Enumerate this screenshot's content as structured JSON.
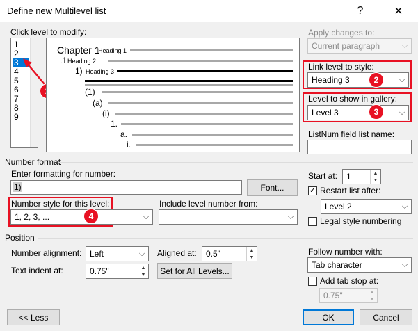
{
  "window": {
    "title": "Define new Multilevel list",
    "help_glyph": "?",
    "close_glyph": "✕"
  },
  "levels": {
    "label": "Click level to modify:",
    "items": [
      "1",
      "2",
      "3",
      "4",
      "5",
      "6",
      "7",
      "8",
      "9"
    ],
    "selected": "3"
  },
  "preview": {
    "chapter_text": "Chapter 1",
    "h1_label": "Heading 1",
    "lvl2_number": ".1",
    "h2_label": "Heading 2",
    "lvl3_number": "1)",
    "h3_label": "Heading 3",
    "lvl5_number": "(1)",
    "lvl6_number": "(a)",
    "lvl7_number": "(i)",
    "lvl8_number": "1.",
    "lvl9_a": "a.",
    "lvl9_i": "i."
  },
  "apply": {
    "label": "Apply changes to:",
    "value": "Current paragraph"
  },
  "link": {
    "label": "Link level to style:",
    "value": "Heading 3"
  },
  "gallery": {
    "label": "Level to show in gallery:",
    "value": "Level 3"
  },
  "listnum": {
    "label": "ListNum field list name:",
    "value": ""
  },
  "number_format": {
    "group_label": "Number format",
    "enter_label": "Enter formatting for number:",
    "enter_value": "1)",
    "font_button": "Font...",
    "style_label": "Number style for this level:",
    "style_value": "1, 2, 3, ...",
    "include_label": "Include level number from:",
    "include_value": "",
    "start_label": "Start at:",
    "start_value": "1",
    "restart_label": "Restart list after:",
    "restart_checked": true,
    "restart_value": "Level 2",
    "legal_label": "Legal style numbering",
    "legal_checked": false
  },
  "position": {
    "group_label": "Position",
    "alignment_label": "Number alignment:",
    "alignment_value": "Left",
    "aligned_at_label": "Aligned at:",
    "aligned_at_value": "0.5\"",
    "indent_label": "Text indent at:",
    "indent_value": "0.75\"",
    "set_all_button": "Set for All Levels...",
    "follow_label": "Follow number with:",
    "follow_value": "Tab character",
    "tabstop_label": "Add tab stop at:",
    "tabstop_checked": false,
    "tabstop_value": "0.75\""
  },
  "buttons": {
    "less": "<< Less",
    "ok": "OK",
    "cancel": "Cancel"
  },
  "annotations": {
    "n1": "1",
    "n2": "2",
    "n3": "3",
    "n4": "4"
  },
  "colors": {
    "accent": "#0078d7",
    "annotation_red": "#e81123"
  }
}
